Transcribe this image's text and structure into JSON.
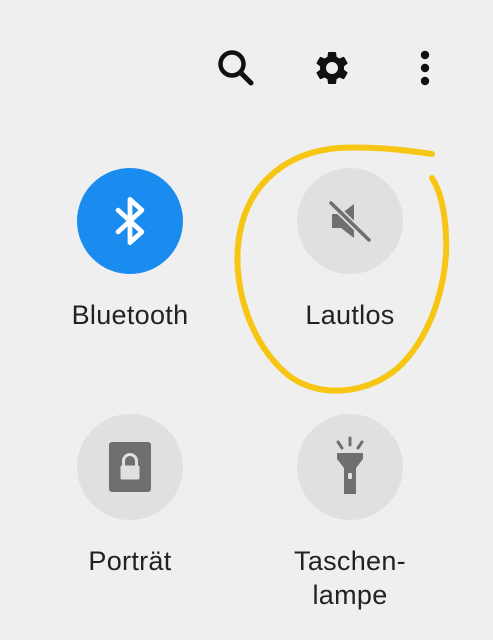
{
  "toolbar": {
    "icons": [
      "search-icon",
      "gear-icon",
      "more-vert-icon"
    ]
  },
  "tiles": [
    {
      "label": "Bluetooth",
      "icon": "bluetooth-icon",
      "state": "on"
    },
    {
      "label": "Lautlos",
      "icon": "volume-mute-icon",
      "state": "off"
    },
    {
      "label": "Porträt",
      "icon": "portrait-lock-icon",
      "state": "off"
    },
    {
      "label_line1": "Taschen-",
      "label_line2": "lampe",
      "icon": "flashlight-icon",
      "state": "off"
    }
  ],
  "colors": {
    "background": "#efefef",
    "active_tile": "#1a8cf0",
    "inactive_tile": "#e0e0e0",
    "inactive_icon": "#6f6f6f",
    "highlight_circle": "#f7c614"
  }
}
